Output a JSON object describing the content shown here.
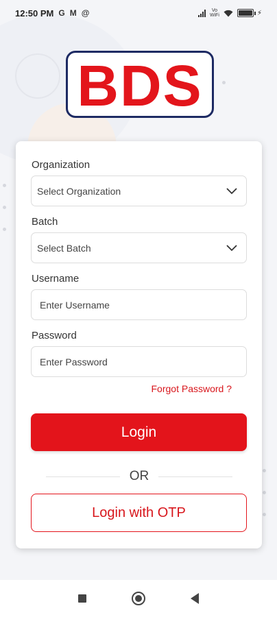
{
  "status_bar": {
    "time": "12:50 PM",
    "left_icons": [
      "G",
      "M",
      "@"
    ],
    "network_label_top": "Vo",
    "network_label_bottom": "WiFi",
    "battery_level": 1.0
  },
  "logo": {
    "text": "BDS"
  },
  "form": {
    "organization": {
      "label": "Organization",
      "placeholder": "Select Organization"
    },
    "batch": {
      "label": "Batch",
      "placeholder": "Select Batch"
    },
    "username": {
      "label": "Username",
      "placeholder": "Enter Username"
    },
    "password": {
      "label": "Password",
      "placeholder": "Enter Password"
    },
    "forgot_password": "Forgot Password ?",
    "login_button": "Login",
    "or_text": "OR",
    "otp_button": "Login with OTP"
  },
  "colors": {
    "accent": "#e3141b",
    "logo_border": "#1d2a63"
  },
  "icons": {
    "dropdown": "chevron-down-icon",
    "nav": [
      "recent-apps-icon",
      "home-icon",
      "back-icon"
    ]
  }
}
